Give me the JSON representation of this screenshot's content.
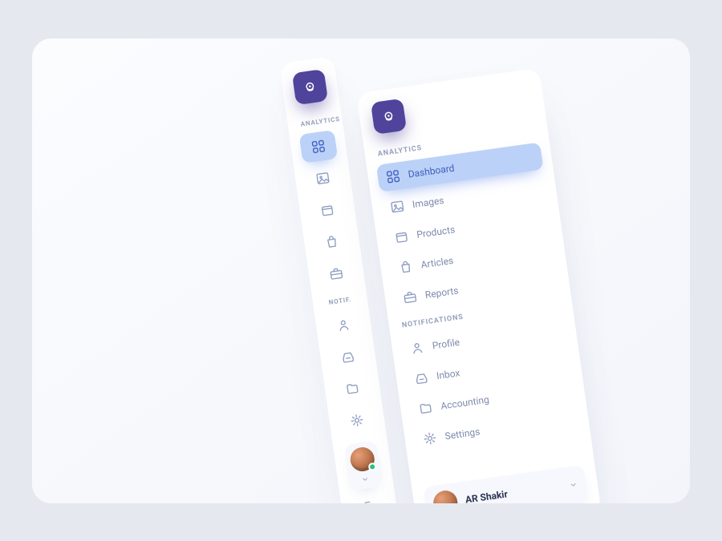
{
  "colors": {
    "brand": "#4f439b",
    "accent_bg": "#bcd1f7",
    "accent_fg": "#3d5fbf"
  },
  "user": {
    "name": "AR Shakir",
    "presence": "online"
  },
  "compact": {
    "sections": {
      "analytics": {
        "label": "ANALYTICS"
      },
      "notifications": {
        "label": "NOTIF."
      }
    }
  },
  "full": {
    "sections": {
      "analytics": {
        "label": "ANALYTICS",
        "items": {
          "dashboard": {
            "label": "Dashboard",
            "active": true
          },
          "images": {
            "label": "Images"
          },
          "products": {
            "label": "Products"
          },
          "articles": {
            "label": "Articles"
          },
          "reports": {
            "label": "Reports"
          }
        }
      },
      "notifications": {
        "label": "NOTIFICATIONS",
        "items": {
          "profile": {
            "label": "Profile"
          },
          "inbox": {
            "label": "Inbox"
          },
          "accounting": {
            "label": "Accounting"
          },
          "settings": {
            "label": "Settings"
          }
        }
      }
    }
  }
}
